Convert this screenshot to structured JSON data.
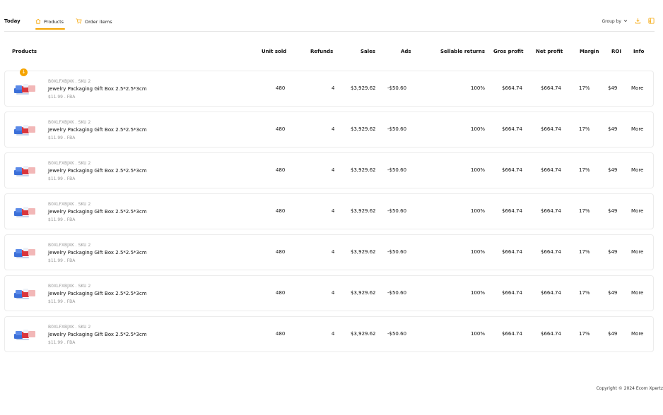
{
  "header": {
    "title": "Today",
    "tabs": [
      {
        "label": "Products",
        "icon": "house-icon",
        "active": true
      },
      {
        "label": "Order items",
        "icon": "cart-icon",
        "active": false
      }
    ],
    "group_by_label": "Group by",
    "accent_color": "#f5a400"
  },
  "table": {
    "columns": [
      "Products",
      "Unit sold",
      "Refunds",
      "Sales",
      "Ads",
      "Sellable returns",
      "Gros profit",
      "Net profit",
      "Margin",
      "ROI",
      "Info"
    ],
    "rows": [
      {
        "sku": "B0XLFXBJXK . SKU 2",
        "name": "Jewelry Packaging Gift Box 2.5*2.5*3cm",
        "meta": "$11.99 . FBA",
        "unit_sold": "480",
        "refunds": "4",
        "sales": "$3,929.62",
        "ads": "-$50.60",
        "sellable_returns": "100%",
        "gros_profit": "$664.74",
        "net_profit": "$664.74",
        "margin": "17%",
        "roi": "$49",
        "info": "More"
      },
      {
        "sku": "B0XLFXBJXK . SKU 2",
        "name": "Jewelry Packaging Gift Box 2.5*2.5*3cm",
        "meta": "$11.99 . FBA",
        "unit_sold": "480",
        "refunds": "4",
        "sales": "$3,929.62",
        "ads": "-$50.60",
        "sellable_returns": "100%",
        "gros_profit": "$664.74",
        "net_profit": "$664.74",
        "margin": "17%",
        "roi": "$49",
        "info": "More"
      },
      {
        "sku": "B0XLFXBJXK . SKU 2",
        "name": "Jewelry Packaging Gift Box 2.5*2.5*3cm",
        "meta": "$11.99 . FBA",
        "unit_sold": "480",
        "refunds": "4",
        "sales": "$3,929.62",
        "ads": "-$50.60",
        "sellable_returns": "100%",
        "gros_profit": "$664.74",
        "net_profit": "$664.74",
        "margin": "17%",
        "roi": "$49",
        "info": "More"
      },
      {
        "sku": "B0XLFXBJXK . SKU 2",
        "name": "Jewelry Packaging Gift Box 2.5*2.5*3cm",
        "meta": "$11.99 . FBA",
        "unit_sold": "480",
        "refunds": "4",
        "sales": "$3,929.62",
        "ads": "-$50.60",
        "sellable_returns": "100%",
        "gros_profit": "$664.74",
        "net_profit": "$664.74",
        "margin": "17%",
        "roi": "$49",
        "info": "More"
      },
      {
        "sku": "B0XLFXBJXK . SKU 2",
        "name": "Jewelry Packaging Gift Box 2.5*2.5*3cm",
        "meta": "$11.99 . FBA",
        "unit_sold": "480",
        "refunds": "4",
        "sales": "$3,929.62",
        "ads": "-$50.60",
        "sellable_returns": "100%",
        "gros_profit": "$664.74",
        "net_profit": "$664.74",
        "margin": "17%",
        "roi": "$49",
        "info": "More"
      },
      {
        "sku": "B0XLFXBJXK . SKU 2",
        "name": "Jewelry Packaging Gift Box 2.5*2.5*3cm",
        "meta": "$11.99 . FBA",
        "unit_sold": "480",
        "refunds": "4",
        "sales": "$3,929.62",
        "ads": "-$50.60",
        "sellable_returns": "100%",
        "gros_profit": "$664.74",
        "net_profit": "$664.74",
        "margin": "17%",
        "roi": "$49",
        "info": "More"
      },
      {
        "sku": "B0XLFXBJXK . SKU 2",
        "name": "Jewelry Packaging Gift Box 2.5*2.5*3cm",
        "meta": "$11.99 . FBA",
        "unit_sold": "480",
        "refunds": "4",
        "sales": "$3,929.62",
        "ads": "-$50.60",
        "sellable_returns": "100%",
        "gros_profit": "$664.74",
        "net_profit": "$664.74",
        "margin": "17%",
        "roi": "$49",
        "info": "More"
      }
    ]
  },
  "footer": {
    "copyright": "Copyright © 2024 Ecom Xpertz"
  }
}
